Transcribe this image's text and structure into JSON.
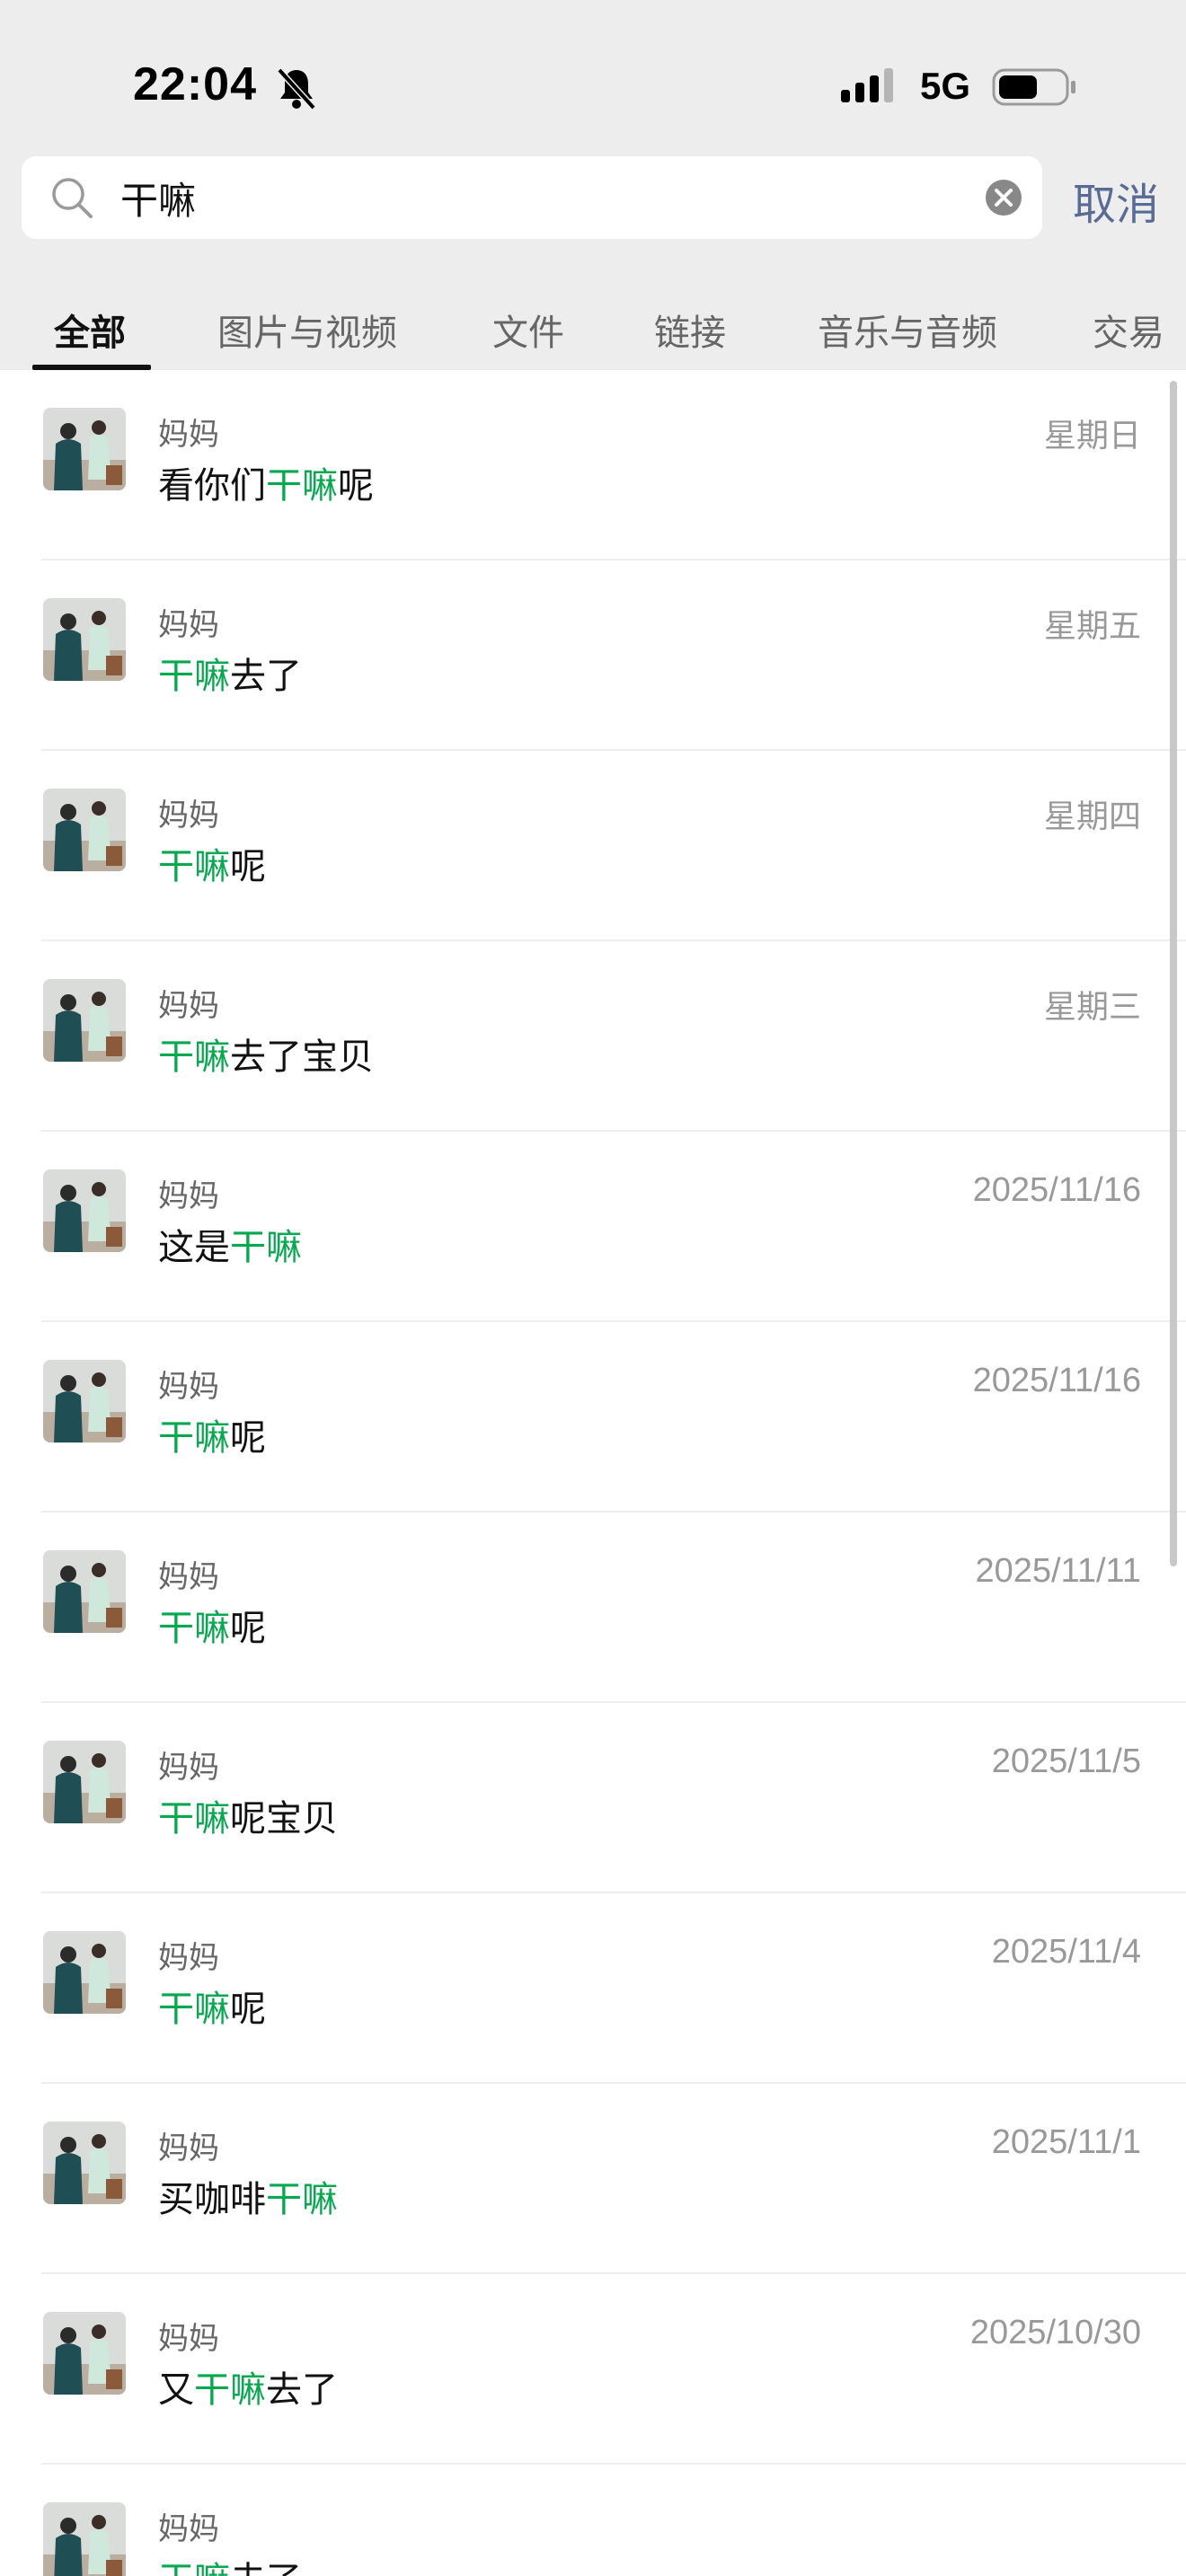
{
  "status_bar": {
    "time": "22:04",
    "network": "5G",
    "icons": [
      "bell-mute-icon",
      "signal-icon",
      "battery-icon"
    ]
  },
  "search": {
    "query": "干嘛",
    "cancel_label": "取消"
  },
  "tabs": [
    {
      "label": "全部",
      "active": true
    },
    {
      "label": "图片与视频"
    },
    {
      "label": "文件"
    },
    {
      "label": "链接"
    },
    {
      "label": "音乐与音频"
    },
    {
      "label": "交易"
    }
  ],
  "colors": {
    "highlight": "#07a84f",
    "cancel_text": "#576b95",
    "background_top": "#ededed"
  },
  "results": [
    {
      "name": "妈妈",
      "date": "星期日",
      "parts": [
        "看你们",
        "干嘛",
        "呢"
      ]
    },
    {
      "name": "妈妈",
      "date": "星期五",
      "parts": [
        "",
        "干嘛",
        "去了"
      ]
    },
    {
      "name": "妈妈",
      "date": "星期四",
      "parts": [
        "",
        "干嘛",
        "呢"
      ]
    },
    {
      "name": "妈妈",
      "date": "星期三",
      "parts": [
        "",
        "干嘛",
        "去了宝贝"
      ]
    },
    {
      "name": "妈妈",
      "date": "2025/11/16",
      "parts": [
        "这是",
        "干嘛",
        ""
      ]
    },
    {
      "name": "妈妈",
      "date": "2025/11/16",
      "parts": [
        "",
        "干嘛",
        "呢"
      ]
    },
    {
      "name": "妈妈",
      "date": "2025/11/11",
      "parts": [
        "",
        "干嘛",
        "呢"
      ]
    },
    {
      "name": "妈妈",
      "date": "2025/11/5",
      "parts": [
        "",
        "干嘛",
        "呢宝贝"
      ]
    },
    {
      "name": "妈妈",
      "date": "2025/11/4",
      "parts": [
        "",
        "干嘛",
        "呢"
      ]
    },
    {
      "name": "妈妈",
      "date": "2025/11/1",
      "parts": [
        "买咖啡",
        "干嘛",
        ""
      ]
    },
    {
      "name": "妈妈",
      "date": "2025/10/30",
      "parts": [
        "又",
        "干嘛",
        "去了"
      ]
    },
    {
      "name": "妈妈",
      "date": "",
      "parts": [
        "",
        "干嘛",
        "去了"
      ]
    }
  ]
}
